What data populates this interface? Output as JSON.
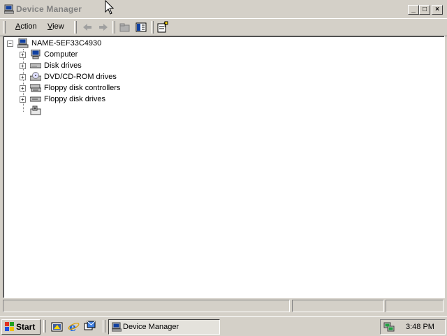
{
  "window": {
    "title": "Device Manager",
    "icon": "computer-icon",
    "controls": [
      "minimize-icon",
      "maximize-icon",
      "close-icon"
    ]
  },
  "toolbar": {
    "menus": [
      {
        "label": "Action",
        "accel": "A"
      },
      {
        "label": "View",
        "accel": "V"
      }
    ],
    "buttons": [
      "back-arrow-icon",
      "forward-arrow-icon",
      "up-folder-icon",
      "show-hide-tree-icon",
      "properties-help-icon"
    ]
  },
  "tree": {
    "root": {
      "label": "NAME-5EF33C4930",
      "expanded": true,
      "icon": "computer-icon"
    },
    "children": [
      {
        "label": "Computer",
        "icon": "monitor-icon"
      },
      {
        "label": "Disk drives",
        "icon": "disk-drive-icon"
      },
      {
        "label": "DVD/CD-ROM drives",
        "icon": "cdrom-icon"
      },
      {
        "label": "Floppy disk controllers",
        "icon": "floppy-controller-icon"
      },
      {
        "label": "Floppy disk drives",
        "icon": "floppy-drive-icon"
      },
      {
        "label": "",
        "icon": "unknown-device-icon"
      }
    ]
  },
  "statusbar": {
    "panels": [
      "",
      "",
      ""
    ]
  },
  "taskbar": {
    "start_label": "Start",
    "quick_launch": [
      "show-desktop-icon",
      "internet-explorer-icon",
      "outlook-express-icon"
    ],
    "tasks": [
      {
        "label": "Device Manager",
        "icon": "computer-icon",
        "active": true
      }
    ],
    "tray_icons": [
      "network-icon"
    ],
    "clock": "3:48 PM"
  },
  "colors": {
    "face": "#d4d0c8",
    "shadow": "#808080",
    "title_inactive_text": "#808080",
    "window_bg": "#ffffff"
  }
}
